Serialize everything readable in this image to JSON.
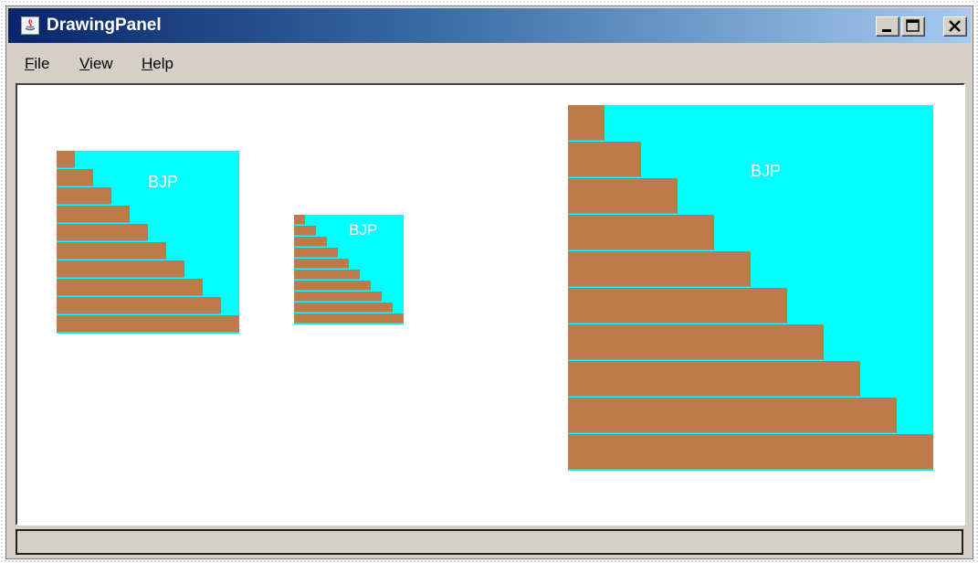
{
  "window": {
    "title": "DrawingPanel",
    "app_icon": "java-icon",
    "controls": [
      "minimize-icon",
      "maximize-icon",
      "close-icon"
    ]
  },
  "menu": {
    "items": [
      "File",
      "View",
      "Help"
    ]
  },
  "drawing": {
    "label": "BJP",
    "colors": {
      "background": "#00ffff",
      "stairs": "#bf7a4b",
      "label": "#ffffff",
      "stair_separator": "#00ffff"
    },
    "figures": [
      {
        "steps": 10
      },
      {
        "steps": 10
      },
      {
        "steps": 10
      }
    ]
  },
  "status": {
    "text": ""
  }
}
